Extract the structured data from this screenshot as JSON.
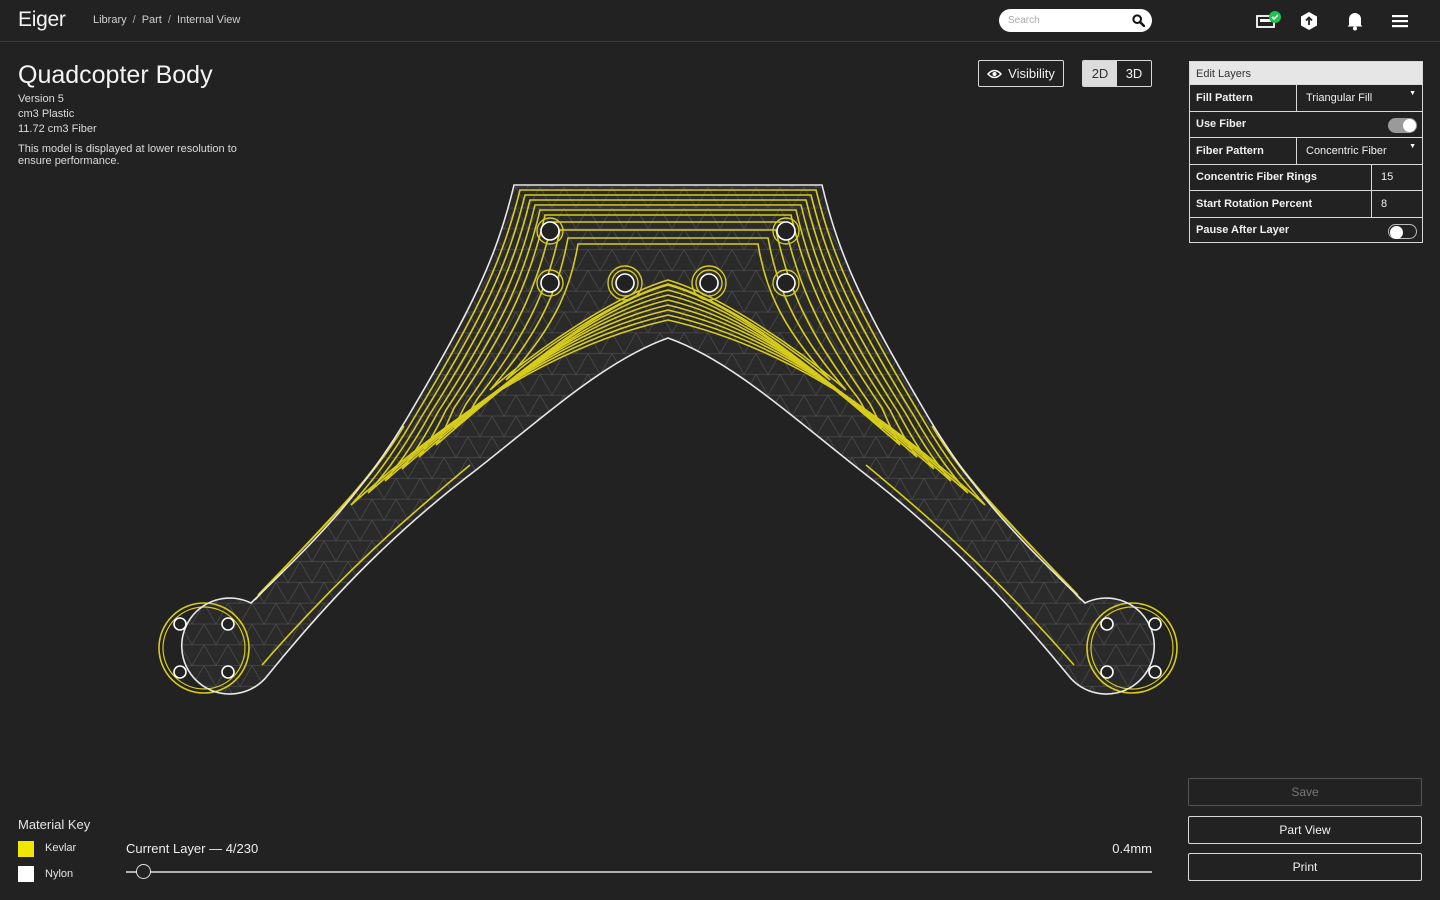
{
  "app": {
    "name": "Eiger"
  },
  "breadcrumb": {
    "library": "Library",
    "part": "Part",
    "view": "Internal View",
    "sep": "/"
  },
  "search": {
    "placeholder": "Search"
  },
  "part": {
    "title": "Quadcopter Body",
    "version": "Version 5",
    "plastic": "cm3 Plastic",
    "fiber": "11.72 cm3 Fiber",
    "note": "This model is displayed at lower resolution to ensure performance."
  },
  "view": {
    "visibility_label": "Visibility",
    "mode_2d": "2D",
    "mode_3d": "3D",
    "active_mode": "2D"
  },
  "edit_layers": {
    "title": "Edit Layers",
    "fill_pattern": {
      "label": "Fill Pattern",
      "value": "Triangular Fill"
    },
    "use_fiber": {
      "label": "Use Fiber",
      "on": true
    },
    "fiber_pattern": {
      "label": "Fiber Pattern",
      "value": "Concentric Fiber"
    },
    "rings": {
      "label": "Concentric Fiber Rings",
      "value": "15"
    },
    "rotation": {
      "label": "Start Rotation Percent",
      "value": "8"
    },
    "pause": {
      "label": "Pause After Layer",
      "on": false
    }
  },
  "actions": {
    "save": "Save",
    "part_view": "Part View",
    "print": "Print"
  },
  "material_key": {
    "title": "Material Key",
    "items": [
      {
        "label": "Kevlar",
        "color": "#f2e600"
      },
      {
        "label": "Nylon",
        "color": "#ffffff"
      }
    ]
  },
  "layer": {
    "label": "Current Layer  —  4/230",
    "current": 4,
    "total": 230,
    "height": "0.4mm"
  },
  "colors": {
    "background": "#222222",
    "fiber": "#d8cc1a",
    "outline": "#e8e8e8",
    "infill": "#3c3c3c"
  },
  "icons": [
    "search-icon",
    "printer-status-icon",
    "upload-icon",
    "bell-icon",
    "menu-icon",
    "eye-icon"
  ]
}
